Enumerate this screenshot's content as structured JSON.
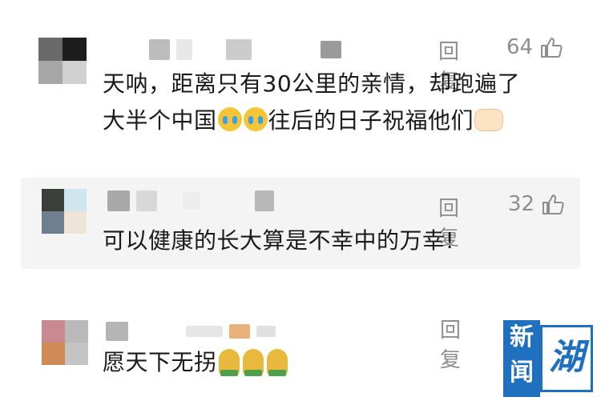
{
  "comments": [
    {
      "text_lines": [
        "天呐，距离只有30公里的亲情，却跑遍了",
        "大半个中国",
        "往后的日子祝福他们"
      ],
      "reply_label": "回复",
      "likes": "64"
    },
    {
      "text": "可以健康的长大算是不幸中的万幸!",
      "reply_label": "回复",
      "likes": "32"
    },
    {
      "text": "愿天下无拐",
      "reply_label": "回复"
    }
  ],
  "logo": {
    "left_text": "新闻",
    "right_text": "湖"
  },
  "colors": {
    "text": "#1a1a1a",
    "meta": "#8e8e8e",
    "subcomment_bg": "#f4f4f4",
    "logo_blue": "#2070c0"
  },
  "icons": {
    "like": "thumbs-up-icon",
    "crying": "crying-face-icon",
    "heart_hands": "heart-hands-icon",
    "pray": "folded-hands-icon"
  }
}
